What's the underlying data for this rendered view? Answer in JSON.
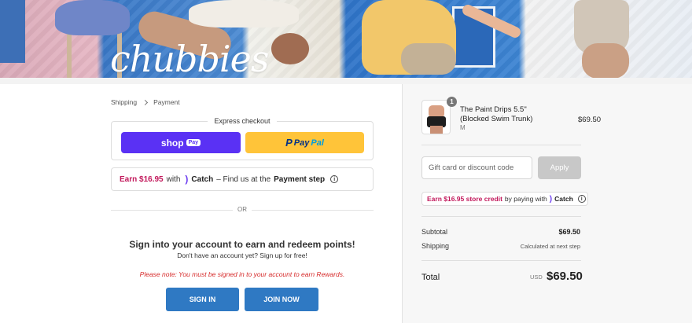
{
  "brand": {
    "logo_text": "chubbies"
  },
  "breadcrumb": {
    "items": [
      "Shipping",
      "Payment"
    ]
  },
  "express": {
    "title": "Express checkout",
    "shop_label": "shop",
    "shop_badge": "Pay",
    "paypal_p": "P",
    "paypal_pay": "Pay",
    "paypal_pal": "Pal"
  },
  "catch_promo": {
    "earn": "Earn $16.95",
    "with": "with",
    "catch_word": "Catch",
    "middle": "– Find us at the",
    "step": "Payment step",
    "info": "i"
  },
  "divider_or": "OR",
  "rewards": {
    "title": "Sign into your account to earn and redeem points!",
    "subtitle": "Don't have an account yet? Sign up for free!",
    "note": "Please note: You must be signed in to your account to earn Rewards.",
    "sign_in": "SIGN IN",
    "join_now": "JOIN NOW"
  },
  "order": {
    "product": {
      "name": "The Paint Drips 5.5\" (Blocked Swim Trunk)",
      "variant": "M",
      "quantity": "1",
      "price": "$69.50"
    },
    "discount": {
      "placeholder": "Gift card or discount code",
      "apply": "Apply"
    },
    "catch_credit": {
      "earn": "Earn $16.95 store credit",
      "text": "by paying with",
      "catch_word": "Catch",
      "info": "i"
    },
    "subtotal_label": "Subtotal",
    "subtotal_value": "$69.50",
    "shipping_label": "Shipping",
    "shipping_value": "Calculated at next step",
    "total_label": "Total",
    "total_currency": "USD",
    "total_value": "$69.50"
  }
}
